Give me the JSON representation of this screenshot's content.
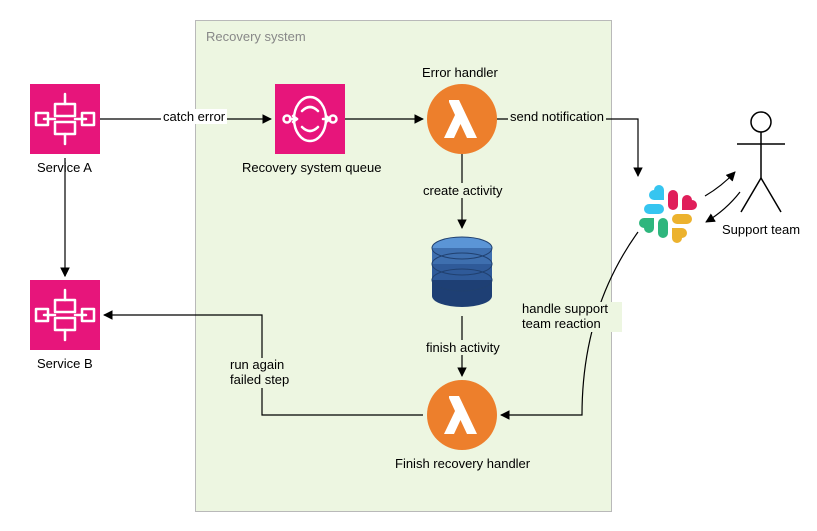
{
  "group": {
    "title": "Recovery system"
  },
  "nodes": {
    "serviceA": {
      "label": "Service A"
    },
    "serviceB": {
      "label": "Service B"
    },
    "queue": {
      "label": "Recovery system queue"
    },
    "errorHandler": {
      "label": "Error handler"
    },
    "finishHandler": {
      "label": "Finish recovery handler"
    },
    "supportTeam": {
      "label": "Support team"
    }
  },
  "edges": {
    "catchError": {
      "label": "catch error"
    },
    "sendNotif": {
      "label": "send notification"
    },
    "createActivity": {
      "label": "create activity"
    },
    "finishActivity": {
      "label": "finish activity"
    },
    "handleReaction": {
      "label": "handle support\nteam reaction"
    },
    "runAgain": {
      "label": "run again\nfailed step"
    }
  }
}
